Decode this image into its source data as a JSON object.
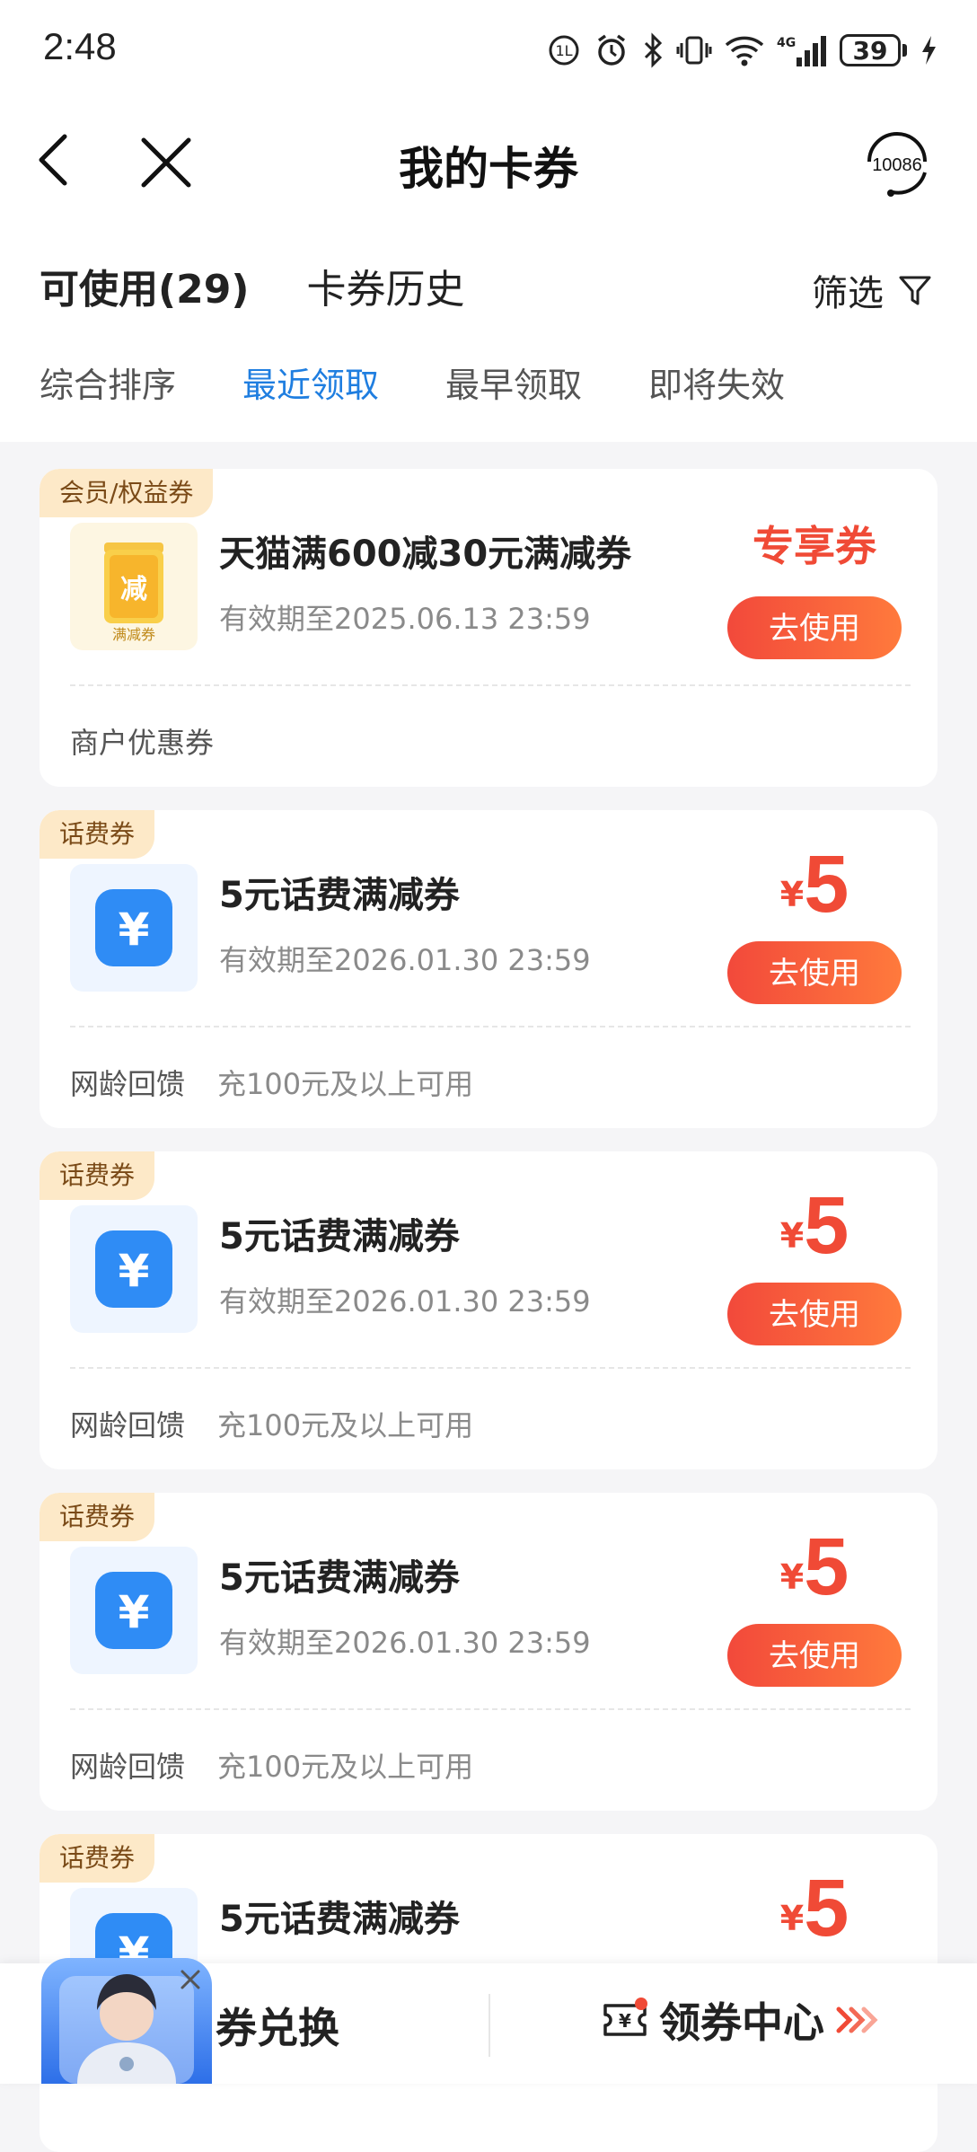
{
  "status_bar": {
    "time": "2:48",
    "battery": "39",
    "network": "4G"
  },
  "nav": {
    "title": "我的卡券",
    "service_label": "10086"
  },
  "tabs": [
    {
      "label": "可使用(29)",
      "active": true
    },
    {
      "label": "卡券历史",
      "active": false
    }
  ],
  "filter": {
    "label": "筛选"
  },
  "sort_options": [
    {
      "label": "综合排序",
      "active": false
    },
    {
      "label": "最近领取",
      "active": true
    },
    {
      "label": "最早领取",
      "active": false
    },
    {
      "label": "即将失效",
      "active": false
    }
  ],
  "coupons": [
    {
      "tag": "会员/权益券",
      "title": "天猫满600减30元满减券",
      "validity": "有效期至2025.06.13 23:59",
      "badge": "专享券",
      "button": "去使用",
      "footer": "商户优惠券",
      "icon": "discount-coupon-icon",
      "icon_text": "减",
      "icon_subtext": "满减券"
    },
    {
      "tag": "话费券",
      "title": "5元话费满减券",
      "validity": "有效期至2026.01.30 23:59",
      "currency": "¥",
      "amount": "5",
      "button": "去使用",
      "footer": "网龄回馈",
      "condition": "充100元及以上可用",
      "icon": "yuan-icon",
      "icon_text": "¥"
    },
    {
      "tag": "话费券",
      "title": "5元话费满减券",
      "validity": "有效期至2026.01.30 23:59",
      "currency": "¥",
      "amount": "5",
      "button": "去使用",
      "footer": "网龄回馈",
      "condition": "充100元及以上可用",
      "icon": "yuan-icon",
      "icon_text": "¥"
    },
    {
      "tag": "话费券",
      "title": "5元话费满减券",
      "validity": "有效期至2026.01.30 23:59",
      "currency": "¥",
      "amount": "5",
      "button": "去使用",
      "footer": "网龄回馈",
      "condition": "充100元及以上可用",
      "icon": "yuan-icon",
      "icon_text": "¥"
    },
    {
      "tag": "话费券",
      "title": "5元话费满减券",
      "currency": "¥",
      "amount": "5",
      "icon": "yuan-icon",
      "icon_text": "¥"
    }
  ],
  "bottom_bar": {
    "left_label": "券兑换",
    "right_label": "领券中心"
  },
  "colors": {
    "accent_red": "#f04a36",
    "active_blue": "#1f7ee0",
    "tag_bg": "#fde9c8"
  }
}
